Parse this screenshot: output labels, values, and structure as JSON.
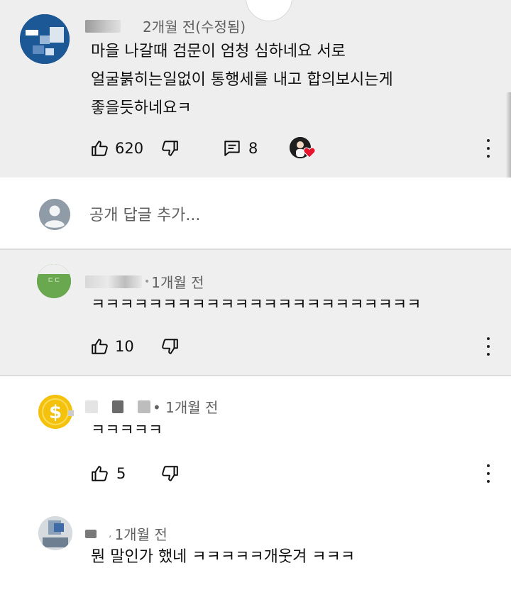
{
  "comment1": {
    "time": "2개월 전(수정됨)",
    "lines": [
      "마을 나갈때 검문이 엄청 심하네요 서로",
      "얼굴붉히는일없이  통행세를 내고 합의보시는게",
      "좋을듯하네요ㅋ"
    ],
    "likes": "620",
    "replies": "8"
  },
  "reply_bar": {
    "placeholder": "공개 답글 추가..."
  },
  "comment2": {
    "time": "1개월 전",
    "text": "ㅋㅋㅋㅋㅋㅋㅋㅋㅋㅋㅋㅋㅋㅋㅋㅋㅋㅋㅋㅋㅋㅋㅋ",
    "likes": "10"
  },
  "comment3": {
    "time": "• 1개월 전",
    "text": "ㅋㅋㅋㅋㅋ",
    "likes": "5"
  },
  "comment4": {
    "time": "1개월 전",
    "text": "뭔 말인가 했네 ㅋㅋㅋㅋㅋ개웃겨 ㅋㅋㅋ"
  },
  "icons": {
    "like": "thumbs-up-icon",
    "dislike": "thumbs-down-icon",
    "reply": "reply-comment-icon",
    "creator_heart": "creator-heart-icon",
    "more": "more-vert-icon"
  },
  "colors": {
    "heart": "#e8142e",
    "green_avatar": "#6aa84f",
    "coin": "#f4c20d"
  }
}
